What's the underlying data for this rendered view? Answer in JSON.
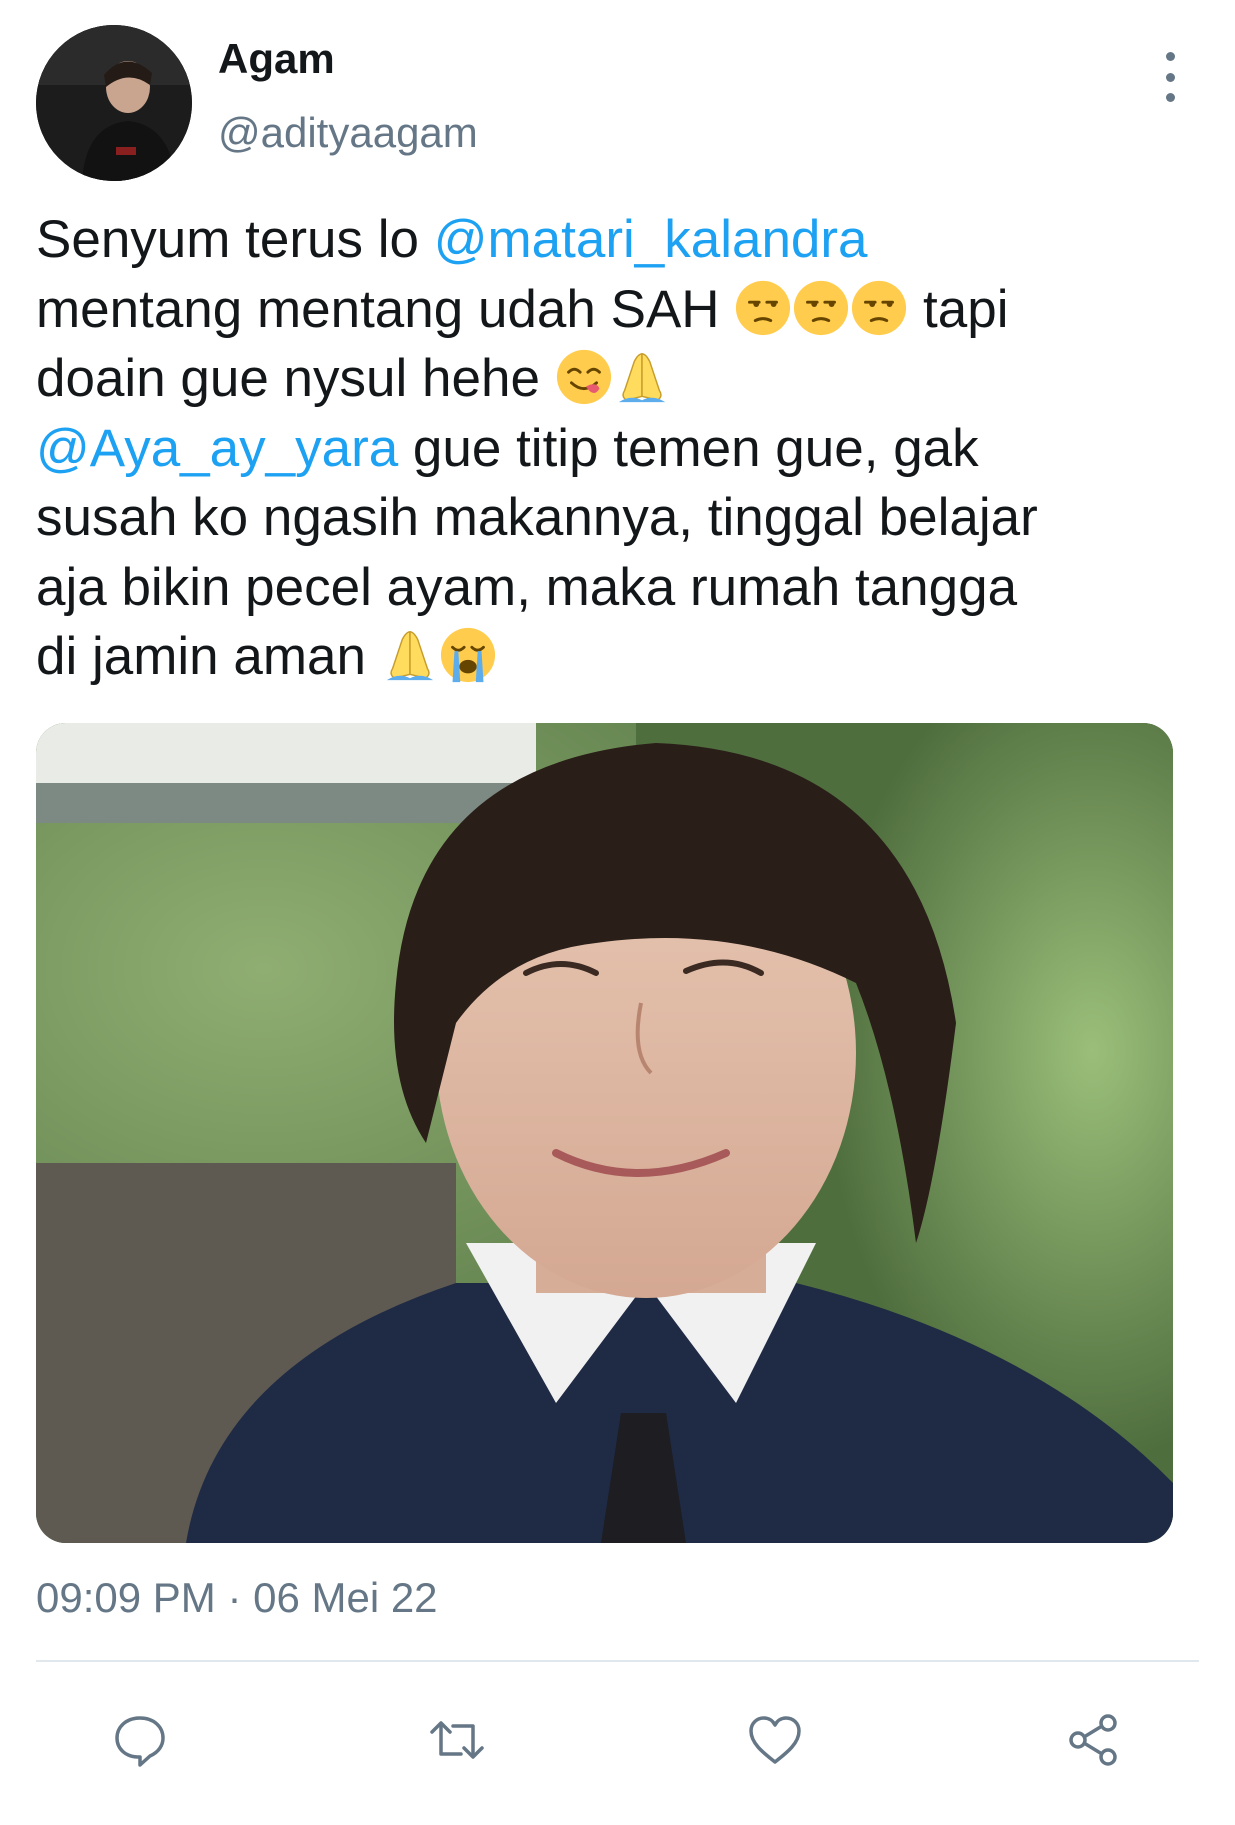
{
  "tweet": {
    "author": {
      "display_name": "Agam",
      "handle": "@adityaagam"
    },
    "text": {
      "line1_pre": "Senyum terus lo ",
      "line1_mention": "@matari_kalandra",
      "line2_pre": "mentang mentang udah SAH ",
      "line2_post": " tapi",
      "line3_pre": "doain gue nysul hehe ",
      "line4_mention": "@Aya_ay_yara",
      "line4_post": " gue titip temen gue, gak",
      "line5": "susah ko ngasih makannya, tinggal belajar",
      "line6": "aja bikin pecel ayam, maka rumah tangga",
      "line7_pre": "di jamin aman "
    },
    "emojis": {
      "line2": [
        "unamused-face",
        "unamused-face",
        "unamused-face"
      ],
      "line3": [
        "face-savoring-food",
        "folded-hands"
      ],
      "line7": [
        "folded-hands",
        "loudly-crying-face"
      ]
    },
    "media": {
      "type": "photo"
    },
    "timestamp": "09:09 PM · 06 Mei 22"
  },
  "actions": [
    "reply-icon",
    "retweet-icon",
    "like-icon",
    "share-icon"
  ],
  "colors": {
    "mention": "#1da1f2",
    "secondary_text": "#657786",
    "primary_text": "#14171a",
    "divider": "#e1e8ed"
  }
}
